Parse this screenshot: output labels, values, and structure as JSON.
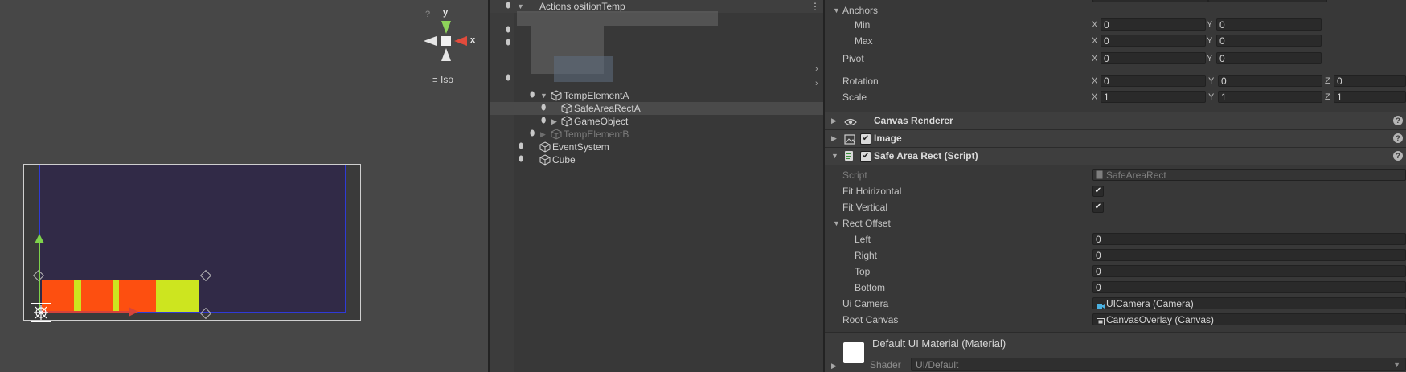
{
  "scene": {
    "gizmo": {
      "y_label": "y",
      "x_label": "x",
      "q_label": "?"
    },
    "iso_label": "Iso"
  },
  "hierarchy": {
    "top_label": "Actions  ositionTemp",
    "items": [
      {
        "name": "TempElementA",
        "expanded": true,
        "selected": false,
        "dim": false
      },
      {
        "name": "SafeAreaRectA",
        "expanded": false,
        "selected": true,
        "dim": false
      },
      {
        "name": "GameObject",
        "expanded": false,
        "selected": false,
        "dim": false
      },
      {
        "name": "TempElementB",
        "expanded": false,
        "selected": false,
        "dim": true
      },
      {
        "name": "EventSystem",
        "expanded": false,
        "selected": false,
        "dim": false
      },
      {
        "name": "Cube",
        "expanded": false,
        "selected": false,
        "dim": false
      }
    ]
  },
  "inspector": {
    "anchors": {
      "label": "Anchors",
      "min": {
        "label": "Min",
        "x": "0",
        "y": "0"
      },
      "max": {
        "label": "Max",
        "x": "0",
        "y": "0"
      }
    },
    "pivot": {
      "label": "Pivot",
      "x": "0",
      "y": "0"
    },
    "rotation": {
      "label": "Rotation",
      "x": "0",
      "y": "0",
      "z": "0"
    },
    "scale": {
      "label": "Scale",
      "x": "1",
      "y": "1",
      "z": "1"
    },
    "axis": {
      "x": "X",
      "y": "Y",
      "z": "Z"
    },
    "components": {
      "canvas_renderer": "Canvas Renderer",
      "image": "Image",
      "safe_area": "Safe Area Rect (Script)"
    },
    "safe_area": {
      "script": {
        "label": "Script",
        "value": "SafeAreaRect"
      },
      "fit_horizontal": {
        "label": "Fit Hoirizontal",
        "checked": true
      },
      "fit_vertical": {
        "label": "Fit Vertical",
        "checked": true
      },
      "rect_offset": {
        "label": "Rect Offset"
      },
      "left": {
        "label": "Left",
        "value": "0"
      },
      "right": {
        "label": "Right",
        "value": "0"
      },
      "top": {
        "label": "Top",
        "value": "0"
      },
      "bottom": {
        "label": "Bottom",
        "value": "0"
      },
      "ui_camera": {
        "label": "Ui Camera",
        "value": "UICamera (Camera)"
      },
      "root_canvas": {
        "label": "Root Canvas",
        "value": "CanvasOverlay (Canvas)"
      }
    },
    "material": {
      "title": "Default UI Material (Material)",
      "shader_label": "Shader",
      "shader_value": "UI/Default"
    },
    "help_glyph": "?"
  },
  "colors": {
    "safe_area_fill": "#312a47",
    "safe_area_border": "#2f3ad6",
    "bar_orange": "#fd4f10",
    "bar_lime": "#cde51f",
    "handle_green": "#7ed34b",
    "handle_red": "#d7433a"
  }
}
